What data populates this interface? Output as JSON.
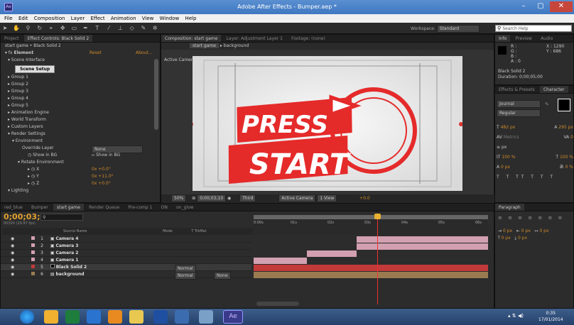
{
  "window": {
    "title": "Adobe After Effects - Bumper.aep *",
    "app_icon": "Ae",
    "minimize": "–",
    "maximize": "▢",
    "close": "✕"
  },
  "menu": [
    "File",
    "Edit",
    "Composition",
    "Layer",
    "Effect",
    "Animation",
    "View",
    "Window",
    "Help"
  ],
  "toolbar": {
    "workspace_label": "Workspace:",
    "workspace_value": "Standard",
    "search_placeholder": "Search Help"
  },
  "effect_controls": {
    "tabs": [
      "Project",
      "Effect Controls: Black Solid 2"
    ],
    "layer_path": "start game • Black Solid 2",
    "effect_name": "Element",
    "reset": "Reset",
    "about": "About...",
    "scene_interface": "Scene Interface",
    "scene_setup": "Scene Setup",
    "groups": [
      "Group 1",
      "Group 2",
      "Group 3",
      "Group 4",
      "Group 5"
    ],
    "sections": [
      "Animation Engine",
      "World Transform",
      "Custom Layers",
      "Render Settings"
    ],
    "environment": "Environment",
    "override_layer_label": "Override Layer",
    "override_layer_value": "None",
    "show_in_bg_label": "Show in BG",
    "show_in_bg_check": "Show in BG",
    "rotate_env": "Rotate Environment",
    "rot": [
      {
        "axis": "X",
        "value": "0x +0.0°"
      },
      {
        "axis": "Y",
        "value": "0x +11.0°"
      },
      {
        "axis": "Z",
        "value": "0x +0.0°"
      }
    ],
    "lighting": "Lighting"
  },
  "composition": {
    "tabs": [
      "Composition: start game",
      "Layer: Adjustment Layer 1",
      "Footage: (none)"
    ],
    "breadcrumb": [
      "start game",
      "background"
    ],
    "camera_label": "Active Camera",
    "logo_line1": "PRESS",
    "logo_line2": "START",
    "footer": {
      "zoom": "50%",
      "timecode": "0;00;03;10",
      "res": "Third",
      "camera": "Active Camera",
      "view": "1 View",
      "exposure": "+0.0"
    }
  },
  "right_panels": {
    "info_tabs": [
      "Info",
      "Preview",
      "Audio"
    ],
    "info": {
      "r": "R :",
      "g": "G :",
      "b": "B :",
      "a": "A : 0",
      "x": "X : 1290",
      "y": "Y : 686",
      "layer": "Black Solid 2",
      "dur": "Duration: 0;00;05;00"
    },
    "char_tabs": [
      "Effects & Presets",
      "Character"
    ],
    "font": "Journal",
    "style": "Regular",
    "size": "482 px",
    "leading": "295 px",
    "kerning": "Metrics",
    "tracking": "0",
    "unit": "px",
    "vscale": "100 %",
    "hscale": "100 %",
    "baseline": "0 px",
    "tsume": "0 %",
    "para_tab": "Paragraph",
    "indent": [
      "0 px",
      "0 px",
      "0 px"
    ],
    "space": [
      "0 px",
      "0 px"
    ]
  },
  "timeline": {
    "tabs": [
      "red_blue",
      "Bumper",
      "start game",
      "Render Queue",
      "Pre-comp 1",
      "ON",
      "on_glow"
    ],
    "timecode": "0;00;03;10",
    "fps": "00100 (29.97 fps)",
    "columns": {
      "source": "Source Name",
      "mode": "Mode",
      "trkmat": "T TrkMat"
    },
    "ruler": [
      "0:00s",
      "01s",
      "02s",
      "03s",
      "04s",
      "05s",
      "06s"
    ],
    "layers": [
      {
        "num": "1",
        "name": "Camera 4",
        "color": "#d2a0b0"
      },
      {
        "num": "2",
        "name": "Camera 3",
        "color": "#d2a0b0"
      },
      {
        "num": "3",
        "name": "Camera 2",
        "color": "#d2a0b0"
      },
      {
        "num": "4",
        "name": "Camera 1",
        "color": "#d2a0b0"
      },
      {
        "num": "5",
        "name": "Black Solid 2",
        "color": "#c23a3a",
        "mode": "Normal"
      },
      {
        "num": "6",
        "name": "background",
        "color": "#9a7b50",
        "mode": "Normal",
        "trkmat": "None"
      }
    ]
  },
  "tray": {
    "time": "0:35",
    "date": "17/01/2014"
  }
}
